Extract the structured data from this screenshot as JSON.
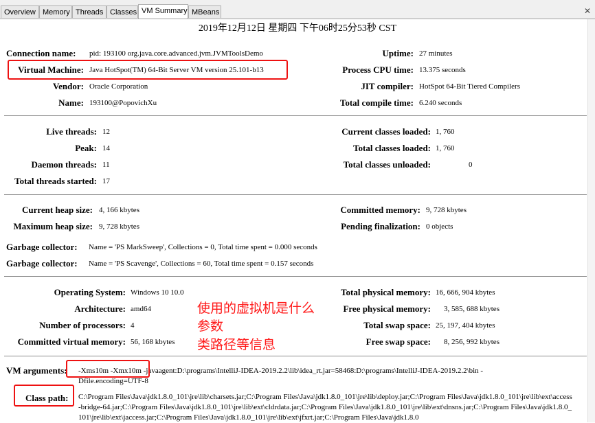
{
  "tabs": [
    "Overview",
    "Memory",
    "Threads",
    "Classes",
    "VM Summary",
    "MBeans"
  ],
  "active_tab": "VM Summary",
  "timestamp": "2019年12月12日 星期四 下午06时25分53秒 CST",
  "section1": {
    "connection_name_label": "Connection name:",
    "connection_name": "pid: 193100 org.java.core.advanced.jvm.JVMToolsDemo",
    "vm_label": "Virtual Machine:",
    "vm": "Java HotSpot(TM) 64-Bit Server VM version 25.101-b13",
    "vendor_label": "Vendor:",
    "vendor": "Oracle Corporation",
    "name_label": "Name:",
    "name": "193100@PopovichXu",
    "uptime_label": "Uptime:",
    "uptime": "27 minutes",
    "cpu_label": "Process CPU time:",
    "cpu": "13.375 seconds",
    "jit_label": "JIT compiler:",
    "jit": "HotSpot 64-Bit Tiered Compilers",
    "compile_label": "Total compile time:",
    "compile": "6.240 seconds"
  },
  "section2": {
    "live_label": "Live threads:",
    "live": "12",
    "peak_label": "Peak:",
    "peak": "14",
    "daemon_label": "Daemon threads:",
    "daemon": "11",
    "started_label": "Total threads started:",
    "started": "17",
    "cur_classes_label": "Current classes loaded:",
    "cur_classes": "1, 760",
    "tot_classes_label": "Total classes loaded:",
    "tot_classes": "1, 760",
    "unloaded_label": "Total classes unloaded:",
    "unloaded": "0"
  },
  "section3": {
    "heap_label": "Current heap size:",
    "heap": "4, 166 kbytes",
    "max_heap_label": "Maximum heap size:",
    "max_heap": "9, 728 kbytes",
    "committed_label": "Committed memory:",
    "committed": "9, 728 kbytes",
    "pending_label": "Pending finalization:",
    "pending": "0 objects",
    "gc1_label": "Garbage collector:",
    "gc1": "Name = 'PS MarkSweep', Collections = 0, Total time spent = 0.000 seconds",
    "gc2_label": "Garbage collector:",
    "gc2": "Name = 'PS Scavenge', Collections = 60, Total time spent = 0.157 seconds"
  },
  "section4": {
    "os_label": "Operating System:",
    "os": "Windows 10 10.0",
    "arch_label": "Architecture:",
    "arch": "amd64",
    "procs_label": "Number of processors:",
    "procs": "4",
    "cvm_label": "Committed virtual memory:",
    "cvm": "56, 168 kbytes",
    "tpm_label": "Total physical memory:",
    "tpm": "16, 666, 904 kbytes",
    "fpm_label": "Free physical memory:",
    "fpm": "3, 585, 688 kbytes",
    "tsw_label": "Total swap space:",
    "tsw": "25, 197, 404 kbytes",
    "fsw_label": "Free swap space:",
    "fsw": "8, 256, 992 kbytes"
  },
  "annotation": {
    "line1": "使用的虚拟机是什么",
    "line2": "参数",
    "line3": "类路径等信息"
  },
  "section5": {
    "vmargs_label": "VM arguments:",
    "vmargs": "-Xms10m -Xmx10m -javaagent:D:\\programs\\IntelliJ-IDEA-2019.2.2\\lib\\idea_rt.jar=58468:D:\\programs\\IntelliJ-IDEA-2019.2.2\\bin -Dfile.encoding=UTF-8",
    "classpath_label": "Class path:",
    "classpath": "C:\\Program Files\\Java\\jdk1.8.0_101\\jre\\lib\\charsets.jar;C:\\Program Files\\Java\\jdk1.8.0_101\\jre\\lib\\deploy.jar;C:\\Program Files\\Java\\jdk1.8.0_101\\jre\\lib\\ext\\access-bridge-64.jar;C:\\Program Files\\Java\\jdk1.8.0_101\\jre\\lib\\ext\\cldrdata.jar;C:\\Program Files\\Java\\jdk1.8.0_101\\jre\\lib\\ext\\dnsns.jar;C:\\Program Files\\Java\\jdk1.8.0_101\\jre\\lib\\ext\\jaccess.jar;C:\\Program Files\\Java\\jdk1.8.0_101\\jre\\lib\\ext\\jfxrt.jar;C:\\Program Files\\Java\\jdk1.8.0"
  },
  "colors": {
    "annotation": "#ff1a1a",
    "highlight_box": "#ee1111",
    "separator": "#8a8a8a"
  }
}
